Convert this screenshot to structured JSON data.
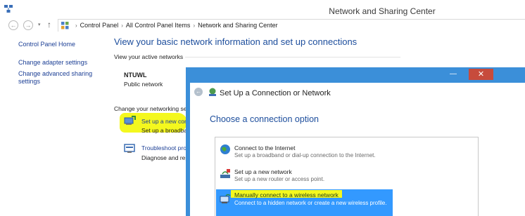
{
  "window": {
    "title": "Network and Sharing Center"
  },
  "address_bar": {
    "back_glyph": "←",
    "forward_glyph": "→",
    "dropdown_glyph": "▾",
    "up_glyph": "↑",
    "breadcrumbs": [
      "Control Panel",
      "All Control Panel Items",
      "Network and Sharing Center"
    ],
    "separator": "›"
  },
  "left_nav": {
    "home": "Control Panel Home",
    "adapter": "Change adapter settings",
    "advanced": "Change advanced sharing settings"
  },
  "main": {
    "title": "View your basic network information and set up connections",
    "active_networks_label": "View your active networks",
    "network_name": "NTUWL",
    "network_type": "Public network",
    "change_settings_label": "Change your networking se",
    "setup_link": "Set up a new con",
    "setup_desc": "Set up a broadban",
    "troubleshoot_link": "Troubleshoot pro",
    "troubleshoot_desc": "Diagnose and rep"
  },
  "dialog": {
    "title": "Set Up a Connection or Network",
    "heading": "Choose a connection option",
    "close_glyph": "✕",
    "minimize_glyph": "—",
    "back_glyph": "←",
    "options": [
      {
        "title": "Connect to the Internet",
        "desc": "Set up a broadband or dial-up connection to the Internet."
      },
      {
        "title": "Set up a new network",
        "desc": "Set up a new router or access point."
      },
      {
        "title": "Manually connect to a wireless network",
        "desc": "Connect to a hidden network or create a new wireless profile."
      }
    ]
  },
  "colors": {
    "link": "#1c3f95",
    "heading": "#1c4d9c",
    "dialog_frame": "#3b8fd9",
    "close": "#c74b3c",
    "highlight": "#f4f81e",
    "selection": "#3399ff"
  }
}
